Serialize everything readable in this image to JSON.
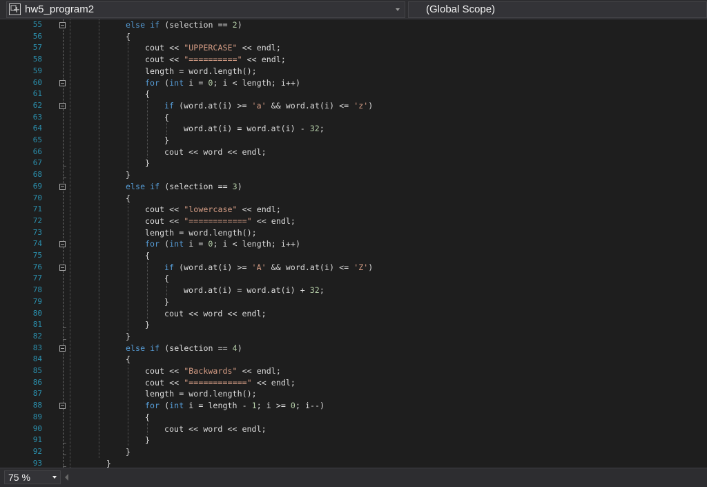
{
  "nav": {
    "project": "hw5_program2",
    "scope": "(Global Scope)"
  },
  "zoom": "75 %",
  "colors": {
    "keyword": "#569cd6",
    "string": "#d69d85",
    "number": "#b5cea8",
    "text": "#dcdcdc",
    "line_number": "#2b91af",
    "background": "#1e1e1e"
  },
  "lines": [
    {
      "n": "55",
      "indent": 2,
      "tokens": [
        [
          "kw",
          "else if"
        ],
        [
          "txt",
          " (selection == "
        ],
        [
          "num",
          "2"
        ],
        [
          "txt",
          ")"
        ]
      ]
    },
    {
      "n": "56",
      "indent": 2,
      "tokens": [
        [
          "txt",
          "{"
        ]
      ]
    },
    {
      "n": "57",
      "indent": 3,
      "tokens": [
        [
          "txt",
          "cout << "
        ],
        [
          "str",
          "\"UPPERCASE\""
        ],
        [
          "txt",
          " << endl;"
        ]
      ]
    },
    {
      "n": "58",
      "indent": 3,
      "tokens": [
        [
          "txt",
          "cout << "
        ],
        [
          "str",
          "\"==========\""
        ],
        [
          "txt",
          " << endl;"
        ]
      ]
    },
    {
      "n": "59",
      "indent": 3,
      "tokens": [
        [
          "txt",
          "length = word.length();"
        ]
      ]
    },
    {
      "n": "60",
      "indent": 3,
      "tokens": [
        [
          "kw",
          "for"
        ],
        [
          "txt",
          " ("
        ],
        [
          "kw",
          "int"
        ],
        [
          "txt",
          " i = "
        ],
        [
          "num",
          "0"
        ],
        [
          "txt",
          "; i < length; i++)"
        ]
      ]
    },
    {
      "n": "61",
      "indent": 3,
      "tokens": [
        [
          "txt",
          "{"
        ]
      ]
    },
    {
      "n": "62",
      "indent": 4,
      "tokens": [
        [
          "kw",
          "if"
        ],
        [
          "txt",
          " (word.at(i) >= "
        ],
        [
          "str",
          "'a'"
        ],
        [
          "txt",
          " && word.at(i) <= "
        ],
        [
          "str",
          "'z'"
        ],
        [
          "txt",
          ")"
        ]
      ]
    },
    {
      "n": "63",
      "indent": 4,
      "tokens": [
        [
          "txt",
          "{"
        ]
      ]
    },
    {
      "n": "64",
      "indent": 5,
      "tokens": [
        [
          "txt",
          "word.at(i) = word.at(i) - "
        ],
        [
          "num",
          "32"
        ],
        [
          "txt",
          ";"
        ]
      ]
    },
    {
      "n": "65",
      "indent": 4,
      "tokens": [
        [
          "txt",
          "}"
        ]
      ]
    },
    {
      "n": "66",
      "indent": 4,
      "tokens": [
        [
          "txt",
          "cout << word << endl;"
        ]
      ]
    },
    {
      "n": "67",
      "indent": 3,
      "tokens": [
        [
          "txt",
          "}"
        ]
      ]
    },
    {
      "n": "68",
      "indent": 2,
      "tokens": [
        [
          "txt",
          "}"
        ]
      ]
    },
    {
      "n": "69",
      "indent": 2,
      "tokens": [
        [
          "kw",
          "else if"
        ],
        [
          "txt",
          " (selection == "
        ],
        [
          "num",
          "3"
        ],
        [
          "txt",
          ")"
        ]
      ]
    },
    {
      "n": "70",
      "indent": 2,
      "tokens": [
        [
          "txt",
          "{"
        ]
      ]
    },
    {
      "n": "71",
      "indent": 3,
      "tokens": [
        [
          "txt",
          "cout << "
        ],
        [
          "str",
          "\"lowercase\""
        ],
        [
          "txt",
          " << endl;"
        ]
      ]
    },
    {
      "n": "72",
      "indent": 3,
      "tokens": [
        [
          "txt",
          "cout << "
        ],
        [
          "str",
          "\"============\""
        ],
        [
          "txt",
          " << endl;"
        ]
      ]
    },
    {
      "n": "73",
      "indent": 3,
      "tokens": [
        [
          "txt",
          "length = word.length();"
        ]
      ]
    },
    {
      "n": "74",
      "indent": 3,
      "tokens": [
        [
          "kw",
          "for"
        ],
        [
          "txt",
          " ("
        ],
        [
          "kw",
          "int"
        ],
        [
          "txt",
          " i = "
        ],
        [
          "num",
          "0"
        ],
        [
          "txt",
          "; i < length; i++)"
        ]
      ]
    },
    {
      "n": "75",
      "indent": 3,
      "tokens": [
        [
          "txt",
          "{"
        ]
      ]
    },
    {
      "n": "76",
      "indent": 4,
      "tokens": [
        [
          "kw",
          "if"
        ],
        [
          "txt",
          " (word.at(i) >= "
        ],
        [
          "str",
          "'A'"
        ],
        [
          "txt",
          " && word.at(i) <= "
        ],
        [
          "str",
          "'Z'"
        ],
        [
          "txt",
          ")"
        ]
      ]
    },
    {
      "n": "77",
      "indent": 4,
      "tokens": [
        [
          "txt",
          "{"
        ]
      ]
    },
    {
      "n": "78",
      "indent": 5,
      "tokens": [
        [
          "txt",
          "word.at(i) = word.at(i) + "
        ],
        [
          "num",
          "32"
        ],
        [
          "txt",
          ";"
        ]
      ]
    },
    {
      "n": "79",
      "indent": 4,
      "tokens": [
        [
          "txt",
          "}"
        ]
      ]
    },
    {
      "n": "80",
      "indent": 4,
      "tokens": [
        [
          "txt",
          "cout << word << endl;"
        ]
      ]
    },
    {
      "n": "81",
      "indent": 3,
      "tokens": [
        [
          "txt",
          "}"
        ]
      ]
    },
    {
      "n": "82",
      "indent": 2,
      "tokens": [
        [
          "txt",
          "}"
        ]
      ]
    },
    {
      "n": "83",
      "indent": 2,
      "tokens": [
        [
          "kw",
          "else if"
        ],
        [
          "txt",
          " (selection == "
        ],
        [
          "num",
          "4"
        ],
        [
          "txt",
          ")"
        ]
      ]
    },
    {
      "n": "84",
      "indent": 2,
      "tokens": [
        [
          "txt",
          "{"
        ]
      ]
    },
    {
      "n": "85",
      "indent": 3,
      "tokens": [
        [
          "txt",
          "cout << "
        ],
        [
          "str",
          "\"Backwards\""
        ],
        [
          "txt",
          " << endl;"
        ]
      ]
    },
    {
      "n": "86",
      "indent": 3,
      "tokens": [
        [
          "txt",
          "cout << "
        ],
        [
          "str",
          "\"============\""
        ],
        [
          "txt",
          " << endl;"
        ]
      ]
    },
    {
      "n": "87",
      "indent": 3,
      "tokens": [
        [
          "txt",
          "length = word.length();"
        ]
      ]
    },
    {
      "n": "88",
      "indent": 3,
      "tokens": [
        [
          "kw",
          "for"
        ],
        [
          "txt",
          " ("
        ],
        [
          "kw",
          "int"
        ],
        [
          "txt",
          " i = length - "
        ],
        [
          "num",
          "1"
        ],
        [
          "txt",
          "; i >= "
        ],
        [
          "num",
          "0"
        ],
        [
          "txt",
          "; i--)"
        ]
      ]
    },
    {
      "n": "89",
      "indent": 3,
      "tokens": [
        [
          "txt",
          "{"
        ]
      ]
    },
    {
      "n": "90",
      "indent": 4,
      "tokens": [
        [
          "txt",
          "cout << word << endl;"
        ]
      ]
    },
    {
      "n": "91",
      "indent": 3,
      "tokens": [
        [
          "txt",
          "}"
        ]
      ]
    },
    {
      "n": "92",
      "indent": 2,
      "tokens": [
        [
          "txt",
          "}"
        ]
      ]
    },
    {
      "n": "93",
      "indent": 1,
      "tokens": [
        [
          "txt",
          "}"
        ]
      ]
    }
  ]
}
